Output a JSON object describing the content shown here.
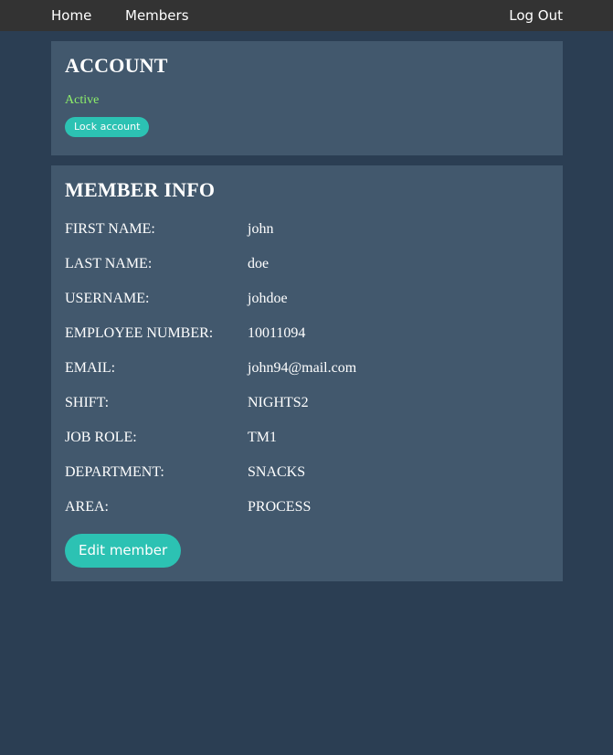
{
  "nav": {
    "home_label": "Home",
    "members_label": "Members",
    "logout_label": "Log Out"
  },
  "account": {
    "title": "ACCOUNT",
    "status": "Active",
    "lock_button_label": "Lock account"
  },
  "member_info": {
    "title": "MEMBER INFO",
    "fields": [
      {
        "label": "FIRST NAME:",
        "value": "john"
      },
      {
        "label": "LAST NAME:",
        "value": "doe"
      },
      {
        "label": "USERNAME:",
        "value": "johdoe"
      },
      {
        "label": "EMPLOYEE NUMBER:",
        "value": "10011094"
      },
      {
        "label": "EMAIL:",
        "value": "john94@mail.com"
      },
      {
        "label": "SHIFT:",
        "value": "NIGHTS2"
      },
      {
        "label": "JOB ROLE:",
        "value": "TM1"
      },
      {
        "label": "DEPARTMENT:",
        "value": "SNACKS"
      },
      {
        "label": "AREA:",
        "value": "PROCESS"
      }
    ],
    "edit_button_label": "Edit member"
  },
  "colors": {
    "background": "#2b3e53",
    "topbar": "#333333",
    "panel": "#42586d",
    "accent": "#2cc2b3",
    "status_active": "#8ef06a"
  }
}
